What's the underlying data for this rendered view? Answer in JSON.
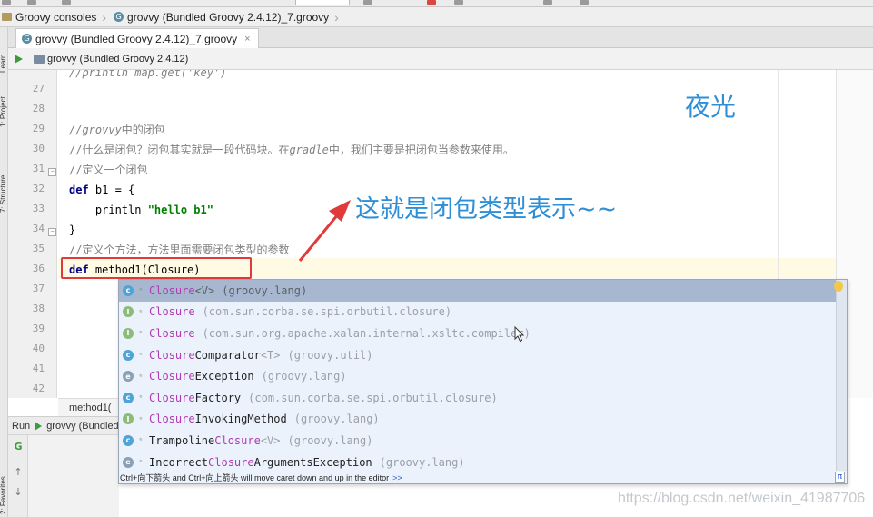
{
  "breadcrumb": {
    "project": "Groovy consoles",
    "file": "grovvy (Bundled Groovy 2.4.12)_7.groovy"
  },
  "tab": {
    "label": "grovvy (Bundled Groovy 2.4.12)_7.groovy",
    "close": "×"
  },
  "run_config": {
    "label": "grovvy (Bundled Groovy 2.4.12)"
  },
  "side_tabs": {
    "learn": "Learn",
    "project": "1: Project",
    "structure": "7: Structure",
    "favorites": "2: Favorites"
  },
  "editor": {
    "line_numbers": [
      "27",
      "28",
      "29",
      "30",
      "31",
      "32",
      "33",
      "34",
      "35",
      "36",
      "37",
      "38",
      "39",
      "40",
      "41",
      "42"
    ],
    "lines": {
      "l26": "//println map.get('key')",
      "l29_a": "//grovvy",
      "l29_b": "中的闭包",
      "l30_a": "//什么是闭包？闭包其实就是一段代码块。在",
      "l30_b": "gradle",
      "l30_c": "中，我们主要是把闭包当参数来使用。",
      "l31": "//定义一个闭包",
      "l32_kw": "def",
      "l32_rest": " b1 = {",
      "l33_a": "    println ",
      "l33_str": "\"hello b1\"",
      "l34": "}",
      "l35": "//定义个方法，方法里面需要闭包类型的参数",
      "l36_kw": "def",
      "l36_rest": " method1(Closure)"
    },
    "status_crumb": "method1("
  },
  "run_panel": {
    "tab_label": "Run",
    "config": "grovvy (Bundled Groovy 2.4.12)"
  },
  "annotations": {
    "title": "夜光",
    "callout": "这就是闭包类型表示~~"
  },
  "completion": {
    "items": [
      {
        "icon": "c",
        "icon_kind": "class",
        "pre": "",
        "match": "Closure",
        "post": "",
        "generic": "<V>",
        "pkg": "(groovy.lang)",
        "selected": true
      },
      {
        "icon": "I",
        "icon_kind": "iface",
        "pre": "",
        "match": "Closure",
        "post": "",
        "generic": "",
        "pkg": "(com.sun.corba.se.spi.orbutil.closure)",
        "selected": false
      },
      {
        "icon": "I",
        "icon_kind": "iface",
        "pre": "",
        "match": "Closure",
        "post": "",
        "generic": "",
        "pkg": "(com.sun.org.apache.xalan.internal.xsltc.compiler)",
        "selected": false
      },
      {
        "icon": "c",
        "icon_kind": "class",
        "pre": "",
        "match": "Closure",
        "post": "Comparator",
        "generic": "<T>",
        "pkg": "(groovy.util)",
        "selected": false
      },
      {
        "icon": "e",
        "icon_kind": "abstract",
        "pre": "",
        "match": "Closure",
        "post": "Exception",
        "generic": "",
        "pkg": "(groovy.lang)",
        "selected": false
      },
      {
        "icon": "c",
        "icon_kind": "class",
        "pre": "",
        "match": "Closure",
        "post": "Factory",
        "generic": "",
        "pkg": "(com.sun.corba.se.spi.orbutil.closure)",
        "selected": false
      },
      {
        "icon": "I",
        "icon_kind": "iface",
        "pre": "",
        "match": "Closure",
        "post": "InvokingMethod",
        "generic": "",
        "pkg": "(groovy.lang)",
        "selected": false
      },
      {
        "icon": "c",
        "icon_kind": "class",
        "pre": "Trampoline",
        "match": "Closure",
        "post": "",
        "generic": "<V>",
        "pkg": "(groovy.lang)",
        "selected": false
      },
      {
        "icon": "e",
        "icon_kind": "abstract",
        "pre": "Incorrect",
        "match": "Closure",
        "post": "ArgumentsException",
        "generic": "",
        "pkg": "(groovy.lang)",
        "selected": false
      }
    ],
    "footer": "Ctrl+向下箭头 and Ctrl+向上箭头 will move caret down and up in the editor",
    "footer_link": ">>",
    "pi": "π"
  },
  "watermark": "https://blog.csdn.net/weixin_41987706",
  "colors": {
    "keyword": "#000080",
    "string": "#008000",
    "comment": "#808080",
    "match": "#b13bb1",
    "annotation": "#2f8fd6",
    "highlight_box": "#e03a3a",
    "selection": "#a6b7cf"
  }
}
